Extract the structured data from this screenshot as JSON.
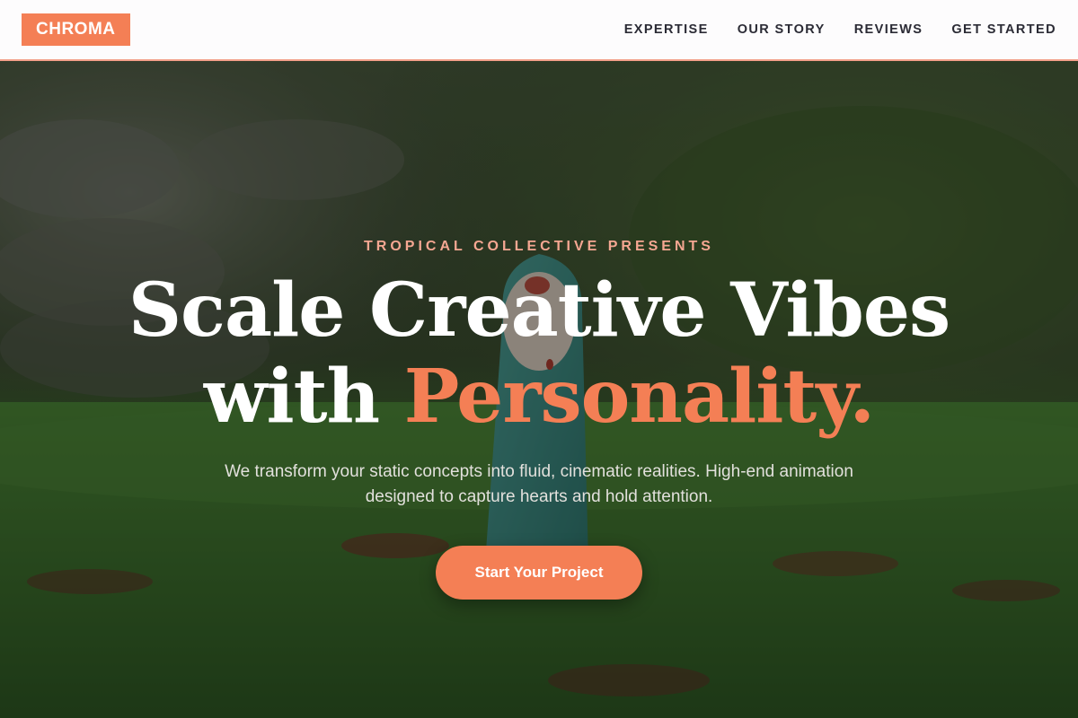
{
  "header": {
    "logo": "CHROMA",
    "nav": [
      "EXPERTISE",
      "OUR STORY",
      "REVIEWS",
      "GET STARTED"
    ]
  },
  "hero": {
    "eyebrow": "TROPICAL COLLECTIVE PRESENTS",
    "headline_line1": "Scale Creative Vibes",
    "headline_line2_plain": "with",
    "headline_line2_accent": "Personality.",
    "subtitle": "We transform your static concepts into fluid, cinematic realities. High-end animation designed to capture hearts and hold attention.",
    "cta_label": "Start Your Project"
  },
  "colors": {
    "accent": "#f47f55",
    "eyebrow": "#f5a792",
    "header_bg": "#fdfcfd",
    "nav_text": "#2b2b35"
  }
}
